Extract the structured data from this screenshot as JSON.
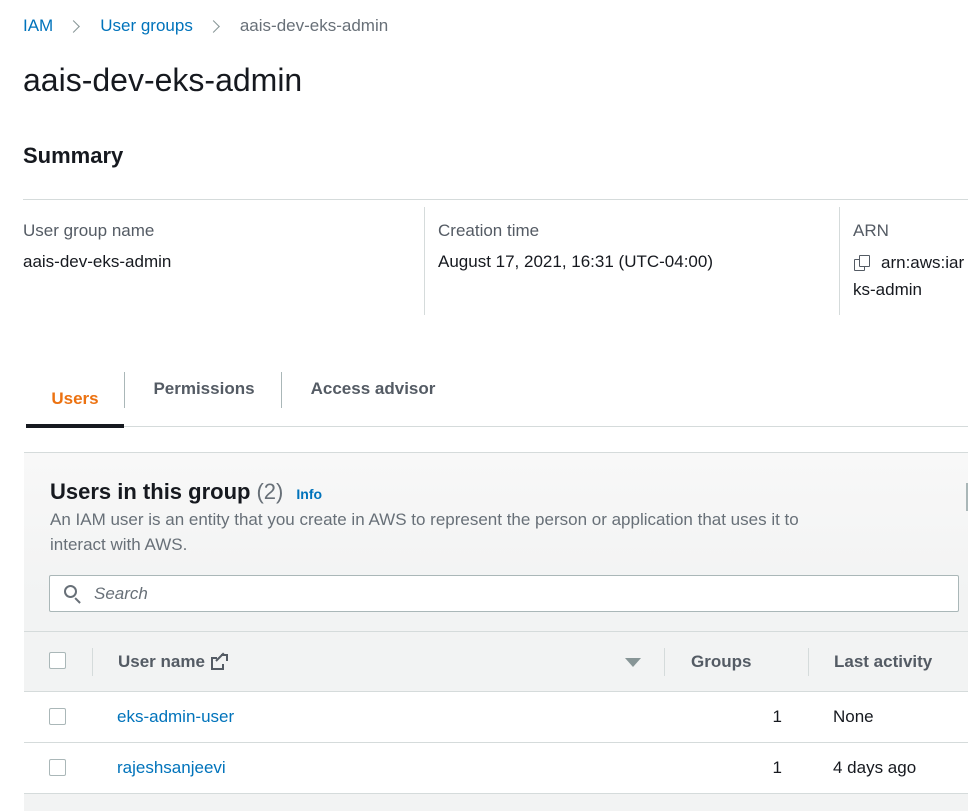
{
  "breadcrumb": {
    "items": [
      "IAM",
      "User groups"
    ],
    "current": "aais-dev-eks-admin"
  },
  "page": {
    "title": "aais-dev-eks-admin"
  },
  "summary": {
    "title": "Summary",
    "group_name_label": "User group name",
    "group_name_value": "aais-dev-eks-admin",
    "creation_label": "Creation time",
    "creation_value": "August 17, 2021, 16:31 (UTC-04:00)",
    "arn_label": "ARN",
    "arn_line1": "arn:aws:iar",
    "arn_line2": "ks-admin"
  },
  "tabs": [
    {
      "label": "Users",
      "active": true
    },
    {
      "label": "Permissions",
      "active": false
    },
    {
      "label": "Access advisor",
      "active": false
    }
  ],
  "users_panel": {
    "title": "Users in this group",
    "count": "(2)",
    "info_label": "Info",
    "description": "An IAM user is an entity that you create in AWS to represent the person or application that uses it to interact with AWS.",
    "search_placeholder": "Search"
  },
  "table": {
    "columns": [
      "User name",
      "Groups",
      "Last activity"
    ],
    "rows": [
      {
        "user_name": "eks-admin-user",
        "groups": "1",
        "last_activity": "None"
      },
      {
        "user_name": "rajeshsanjeevi",
        "groups": "1",
        "last_activity": "4 days ago"
      }
    ]
  },
  "colors": {
    "link": "#0073bb",
    "active_tab": "#ec7211",
    "text": "#16191f",
    "muted": "#687078"
  },
  "icons": [
    "chevron-right-icon",
    "copy-icon",
    "search-icon",
    "external-link-icon",
    "sort-down-icon"
  ]
}
